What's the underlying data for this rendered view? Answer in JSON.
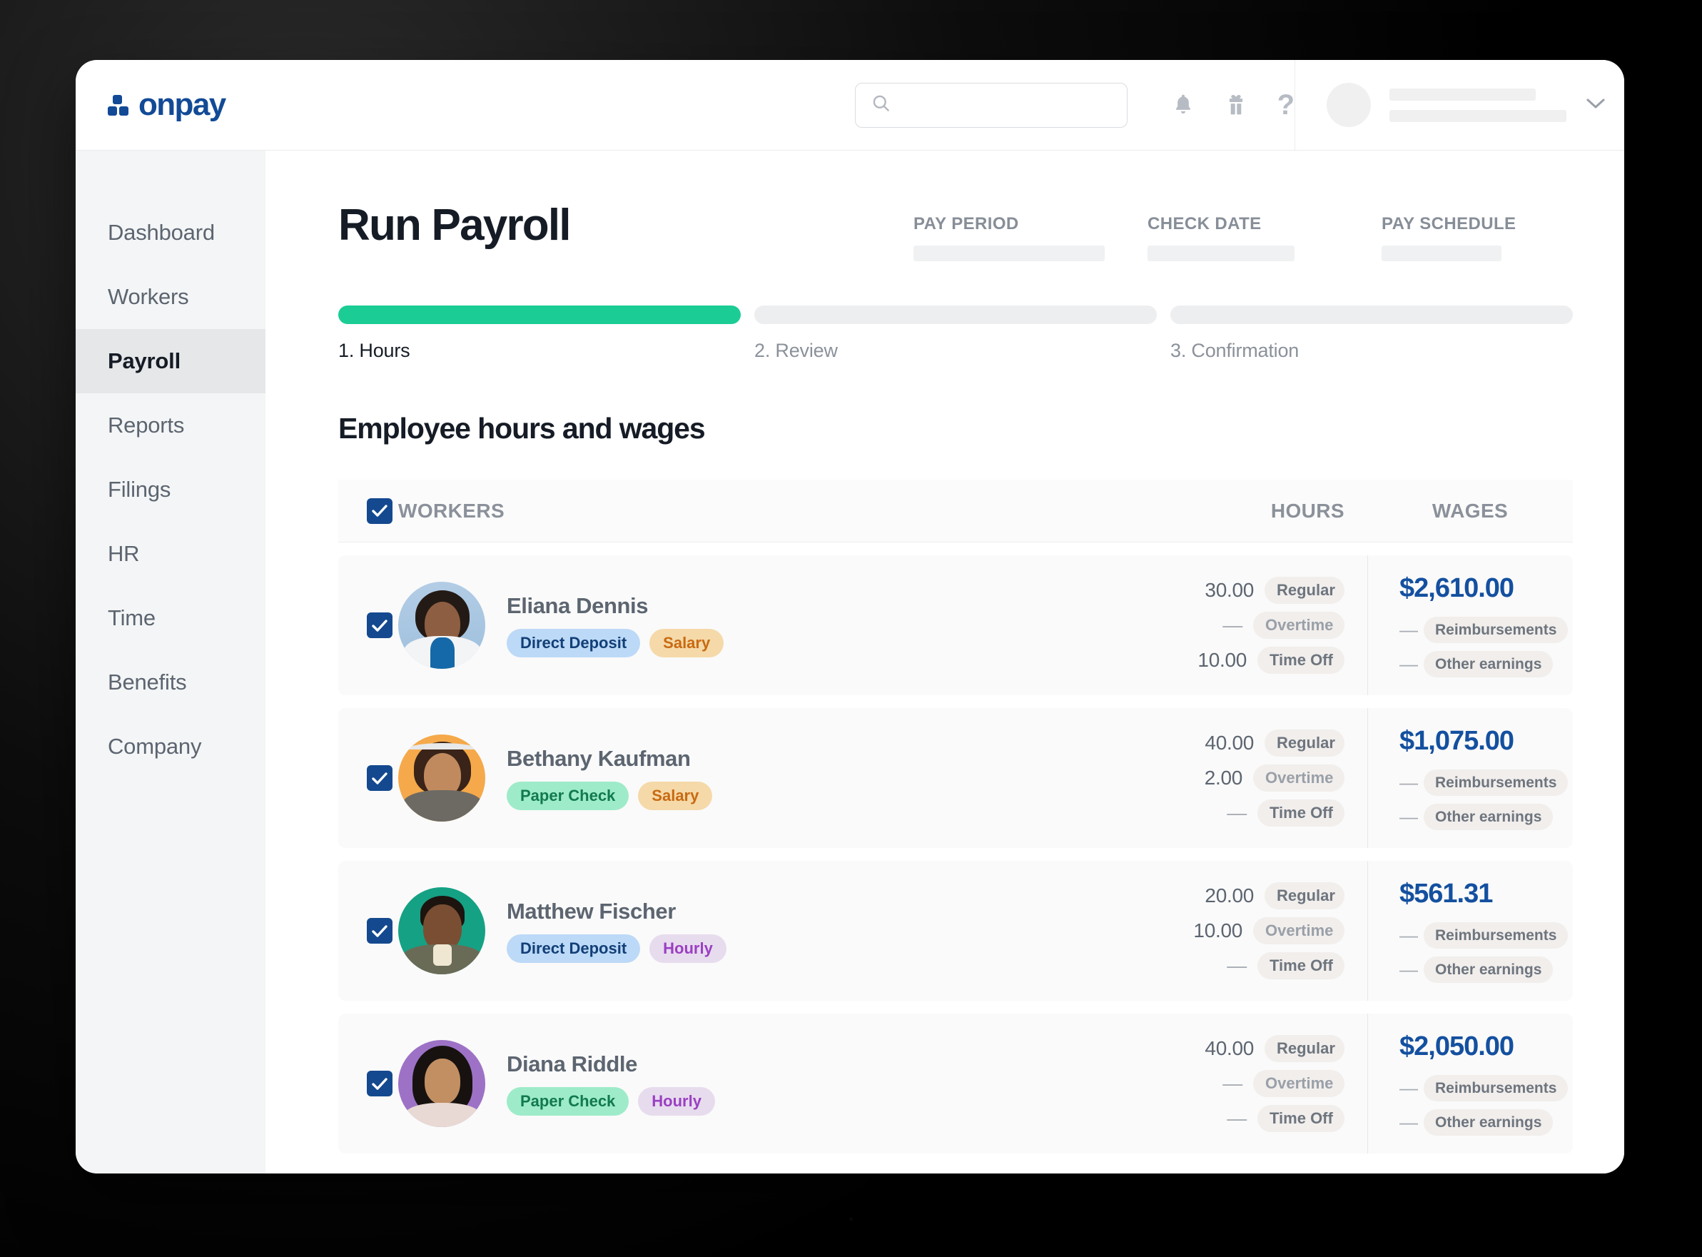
{
  "app": {
    "logo_text": "onpay"
  },
  "topbar": {
    "search_placeholder": "",
    "search_value": "",
    "icons": {
      "search": "search-icon",
      "notifications": "bell-icon",
      "gifts": "gift-icon",
      "help": "?",
      "chevron": "chevron-down-icon"
    }
  },
  "sidebar": {
    "items": [
      {
        "label": "Dashboard",
        "active": false
      },
      {
        "label": "Workers",
        "active": false
      },
      {
        "label": "Payroll",
        "active": true
      },
      {
        "label": "Reports",
        "active": false
      },
      {
        "label": "Filings",
        "active": false
      },
      {
        "label": "HR",
        "active": false
      },
      {
        "label": "Time",
        "active": false
      },
      {
        "label": "Benefits",
        "active": false
      },
      {
        "label": "Company",
        "active": false
      }
    ]
  },
  "main": {
    "page_title": "Run Payroll",
    "meta": [
      {
        "label": "PAY PERIOD",
        "value": ""
      },
      {
        "label": "CHECK DATE",
        "value": ""
      },
      {
        "label": "PAY SCHEDULE",
        "value": ""
      }
    ],
    "steps": [
      {
        "label": "1. Hours",
        "state": "active"
      },
      {
        "label": "2. Review",
        "state": "upcoming"
      },
      {
        "label": "3. Confirmation",
        "state": "upcoming"
      }
    ],
    "section_title": "Employee hours and wages",
    "table": {
      "headers": {
        "workers": "WORKERS",
        "hours": "HOURS",
        "wages": "WAGES"
      },
      "select_all_checked": true,
      "hour_types": {
        "regular": "Regular",
        "overtime": "Overtime",
        "time_off": "Time Off"
      },
      "wage_types": {
        "reimbursements": "Reimbursements",
        "other_earnings": "Other earnings"
      },
      "empty_value": "—",
      "rows": [
        {
          "checked": true,
          "name": "Eliana Dennis",
          "pay_method": "Direct Deposit",
          "pay_type": "Salary",
          "regular": "30.00",
          "overtime": "—",
          "time_off": "10.00",
          "wages": "$2,610.00",
          "reimbursements": "—",
          "other_earnings": "—"
        },
        {
          "checked": true,
          "name": "Bethany Kaufman",
          "pay_method": "Paper Check",
          "pay_type": "Salary",
          "regular": "40.00",
          "overtime": "2.00",
          "time_off": "—",
          "wages": "$1,075.00",
          "reimbursements": "—",
          "other_earnings": "—"
        },
        {
          "checked": true,
          "name": "Matthew Fischer",
          "pay_method": "Direct Deposit",
          "pay_type": "Hourly",
          "regular": "20.00",
          "overtime": "10.00",
          "time_off": "—",
          "wages": "$561.31",
          "reimbursements": "—",
          "other_earnings": "—"
        },
        {
          "checked": true,
          "name": "Diana Riddle",
          "pay_method": "Paper Check",
          "pay_type": "Hourly",
          "regular": "40.00",
          "overtime": "—",
          "time_off": "—",
          "wages": "$2,050.00",
          "reimbursements": "—",
          "other_earnings": "—"
        }
      ]
    }
  },
  "colors": {
    "brand_blue": "#124a96",
    "progress_green": "#1bcd94",
    "wage_blue": "#1450a0",
    "checkbox_blue": "#14498f"
  }
}
